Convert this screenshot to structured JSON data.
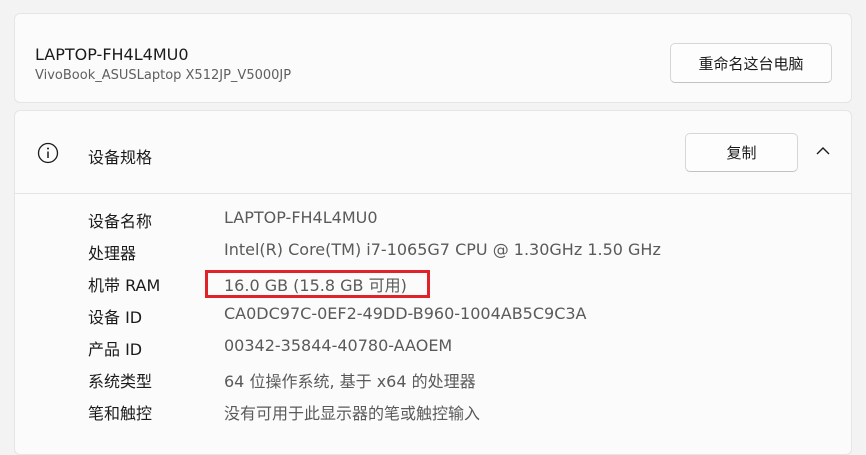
{
  "device": {
    "name": "LAPTOP-FH4L4MU0",
    "model": "VivoBook_ASUSLaptop X512JP_V5000JP",
    "rename_label": "重命名这台电脑"
  },
  "specs": {
    "title": "设备规格",
    "copy_label": "复制",
    "rows": [
      {
        "label": "设备名称",
        "value": "LAPTOP-FH4L4MU0"
      },
      {
        "label": "处理器",
        "value": "Intel(R) Core(TM) i7-1065G7 CPU @ 1.30GHz   1.50 GHz"
      },
      {
        "label": "机带 RAM",
        "value": "16.0 GB (15.8 GB 可用)"
      },
      {
        "label": "设备 ID",
        "value": "CA0DC97C-0EF2-49DD-B960-1004AB5C9C3A"
      },
      {
        "label": "产品 ID",
        "value": "00342-35844-40780-AAOEM"
      },
      {
        "label": "系统类型",
        "value": "64 位操作系统, 基于 x64 的处理器"
      },
      {
        "label": "笔和触控",
        "value": "没有可用于此显示器的笔或触控输入"
      }
    ]
  },
  "colors": {
    "highlight": "#e0232a"
  },
  "icons": {
    "info": "info-icon",
    "collapse": "chevron-up-icon"
  }
}
